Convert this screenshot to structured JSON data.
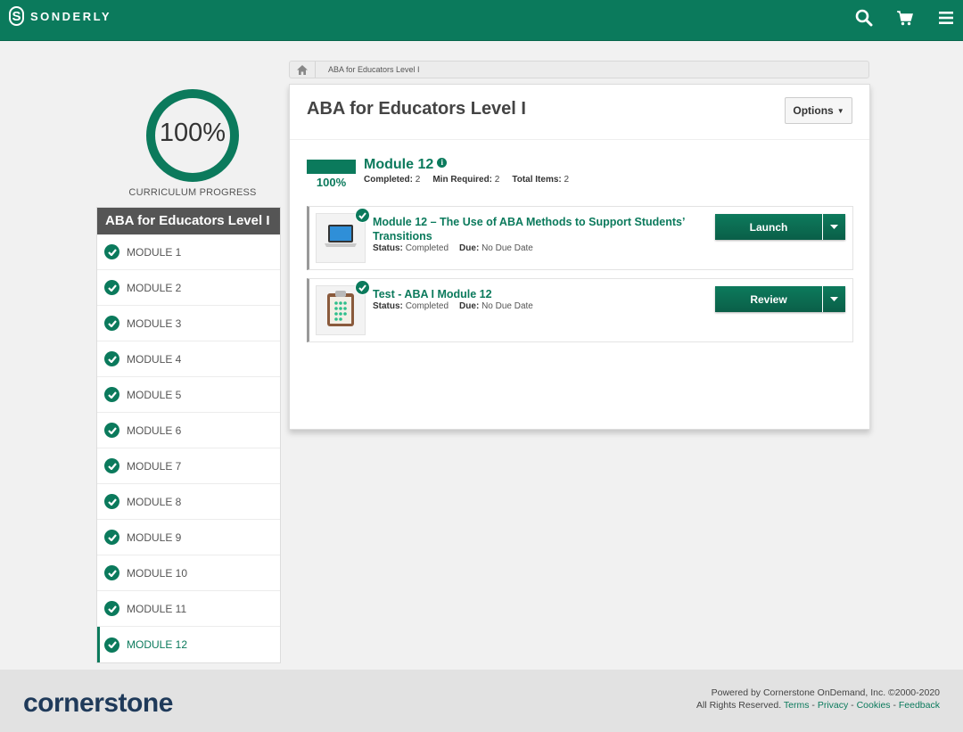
{
  "brand": {
    "name": "SONDERLY",
    "letter": "S"
  },
  "progress": {
    "value": 100,
    "label": "100%",
    "caption": "CURRICULUM PROGRESS"
  },
  "sidebar": {
    "title": "ABA for Educators Level I",
    "items": [
      {
        "label": "MODULE 1"
      },
      {
        "label": "MODULE 2"
      },
      {
        "label": "MODULE 3"
      },
      {
        "label": "MODULE 4"
      },
      {
        "label": "MODULE 5"
      },
      {
        "label": "MODULE 6"
      },
      {
        "label": "MODULE 7"
      },
      {
        "label": "MODULE 8"
      },
      {
        "label": "MODULE 9"
      },
      {
        "label": "MODULE 10"
      },
      {
        "label": "MODULE 11"
      },
      {
        "label": "MODULE 12"
      }
    ],
    "active_index": 11
  },
  "breadcrumb": {
    "label": "ABA for Educators Level I"
  },
  "main": {
    "title": "ABA for Educators Level I",
    "options_label": "Options",
    "module": {
      "title": "Module 12",
      "progress_label": "100%",
      "progress_value": 1.0,
      "completed_label": "Completed:",
      "completed_value": "2",
      "min_label": "Min Required:",
      "min_value": "2",
      "total_label": "Total Items:",
      "total_value": "2"
    },
    "items": [
      {
        "title": "Module 12 – The Use of ABA Methods to Support Students’ Transitions",
        "status_label": "Status:",
        "status_value": "Completed",
        "due_label": "Due:",
        "due_value": "No Due Date",
        "action": "Launch",
        "icon": "laptop-icon"
      },
      {
        "title": "Test - ABA I Module 12",
        "status_label": "Status:",
        "status_value": "Completed",
        "due_label": "Due:",
        "due_value": "No Due Date",
        "action": "Review",
        "icon": "clipboard-icon"
      }
    ]
  },
  "footer": {
    "logo": "cornerstone",
    "powered": "Powered by Cornerstone OnDemand, Inc. ©2000-2020",
    "rights": "All Rights Reserved.",
    "links": [
      "Terms",
      "Privacy",
      "Cookies",
      "Feedback"
    ],
    "separator": " - "
  },
  "colors": {
    "brand": "#0b7a5c",
    "sidebar_title_bg": "#555555",
    "footer_logo": "#1f3a5a"
  }
}
